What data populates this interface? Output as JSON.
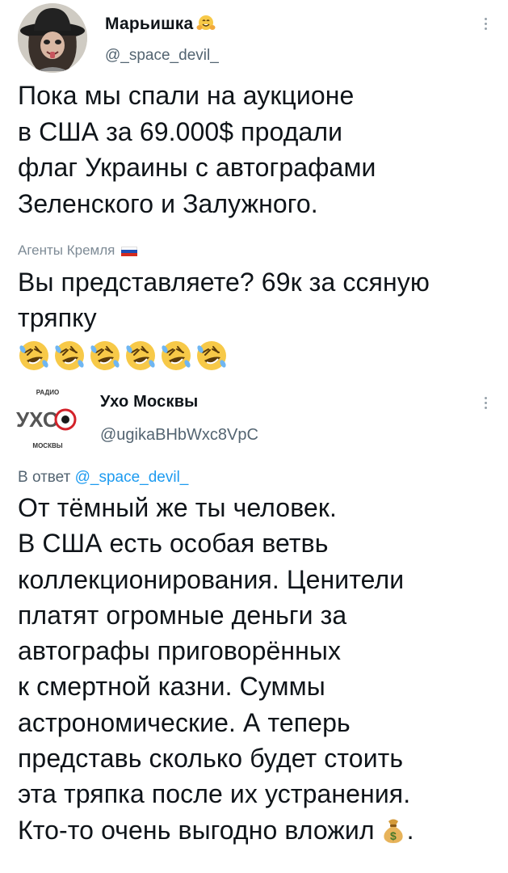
{
  "tweet1": {
    "author_name": "Марьишка",
    "author_emoji_icon": "hugging-face-icon",
    "author_handle": "@_space_devil_",
    "text_lines": [
      "Пока мы спали на аукционе",
      "в США за 69.000$ продали",
      "флаг Украины с автографами",
      "Зеленского и Залужного."
    ],
    "quote_source": "Агенты Кремля",
    "quote_flag_icon": "russian-flag-icon",
    "quote_lines": [
      "Вы представляете? 69к за ссяную",
      "тряпку"
    ],
    "emoji_icon": "rolling-on-floor-laughing-icon",
    "emoji_count": 6
  },
  "tweet2": {
    "author_name": "Ухо Москвы",
    "author_handle": "@ugikaBHbWxc8VpC",
    "logo": {
      "top": "РАДИО",
      "main": "УХО",
      "bottom": "МОСКВЫ"
    },
    "reply_prefix": "В ответ ",
    "reply_handle": "@_space_devil_",
    "text_lines": [
      "От тёмный же ты человек.",
      "В США есть особая ветвь",
      "коллекционирования. Ценители",
      "платят огромные деньги за",
      "автографы приговорённых",
      "к смертной казни. Суммы",
      "астрономические. А теперь",
      "представь сколько будет стоить",
      "эта тряпка после их устранения.",
      "Кто-то очень выгодно вложил"
    ],
    "last_emoji_icon": "money-bag-icon",
    "last_punct": "."
  },
  "colors": {
    "text": "#0f1419",
    "secondary": "#536471",
    "link": "#1d9bf0",
    "emoji_yellow": "#f7c948"
  }
}
